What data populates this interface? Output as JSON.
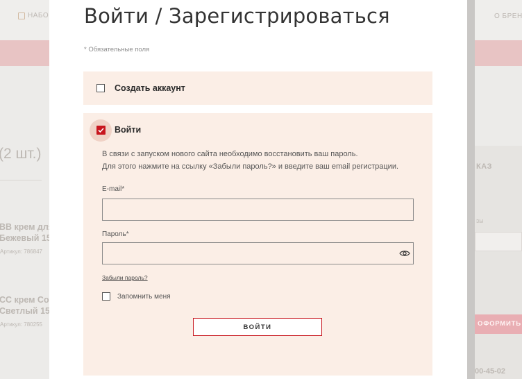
{
  "background": {
    "nav_left": "НАБО",
    "nav_right": "О БРЕНД",
    "cart_title": "(2 шт.)",
    "product1_line1": "ВВ крем для",
    "product1_line2": "Бежевый 15",
    "product1_sku": "Артикул: 786847",
    "product2_line1": "СС крем Сов",
    "product2_line2": "Светлый 15 г",
    "product2_sku": "Артикул: 780255",
    "order_title": "КАЗ",
    "small_label": "ЗЫ",
    "checkout_button": "ОФОРМИТЬ",
    "phone": "00-45-02"
  },
  "modal": {
    "title": "Войти / Зарегистрироваться",
    "required_note": "* Обязательные поля",
    "create_account": {
      "label": "Создать аккаунт",
      "checked": false
    },
    "login": {
      "label": "Войти",
      "checked": true,
      "info_line1": "В связи с запуском нового сайта необходимо восстановить ваш пароль.",
      "info_line2": "Для этого нажмите на ссылку «Забыли пароль?» и введите ваш email регистрации.",
      "email_label": "E-mail*",
      "email_value": "",
      "password_label": "Пароль*",
      "password_value": "",
      "forgot_link": "Забыли пароль?",
      "remember_label": "Запомнить меня",
      "remember_checked": false,
      "submit_label": "ВОЙТИ"
    }
  },
  "colors": {
    "accent": "#c8161e",
    "card_background": "#fbeee6",
    "pink_bar": "#e8c4c4"
  }
}
